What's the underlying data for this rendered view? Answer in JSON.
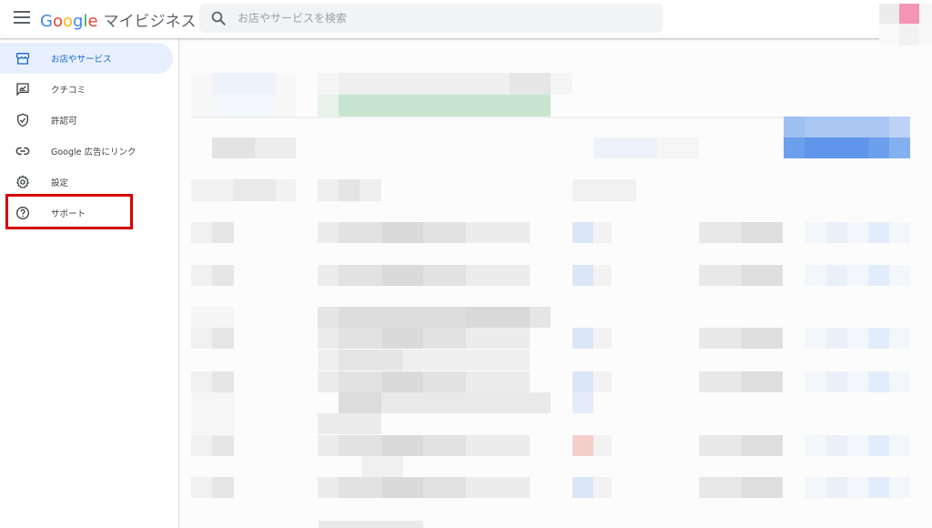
{
  "header": {
    "logo_word": "Google",
    "logo_letters": [
      {
        "char": "G",
        "color": "#4285f4"
      },
      {
        "char": "o",
        "color": "#ea4335"
      },
      {
        "char": "o",
        "color": "#fbbc05"
      },
      {
        "char": "g",
        "color": "#4285f4"
      },
      {
        "char": "l",
        "color": "#34a853"
      },
      {
        "char": "e",
        "color": "#ea4335"
      }
    ],
    "product_name": "マイビジネス",
    "menu_icon": "hamburger-menu-icon",
    "search": {
      "placeholder": "お店やサービスを検索",
      "value": "",
      "icon": "search-icon"
    },
    "account_icon": "avatar"
  },
  "sidebar": {
    "items": [
      {
        "label": "お店やサービス",
        "icon": "storefront-icon",
        "active": true
      },
      {
        "label": "クチコミ",
        "icon": "review-icon",
        "active": false
      },
      {
        "label": "許認可",
        "icon": "verified-shield-icon",
        "active": false
      },
      {
        "label": "Google 広告にリンク",
        "icon": "link-icon",
        "active": false
      },
      {
        "label": "設定",
        "icon": "gear-icon",
        "active": false
      },
      {
        "label": "サポート",
        "icon": "help-circle-icon",
        "active": false
      }
    ],
    "highlighted_item": "サポート"
  },
  "colors": {
    "accent": "#1967d2",
    "active_bg": "#e8f0fe",
    "highlight_border": "#d40000"
  }
}
